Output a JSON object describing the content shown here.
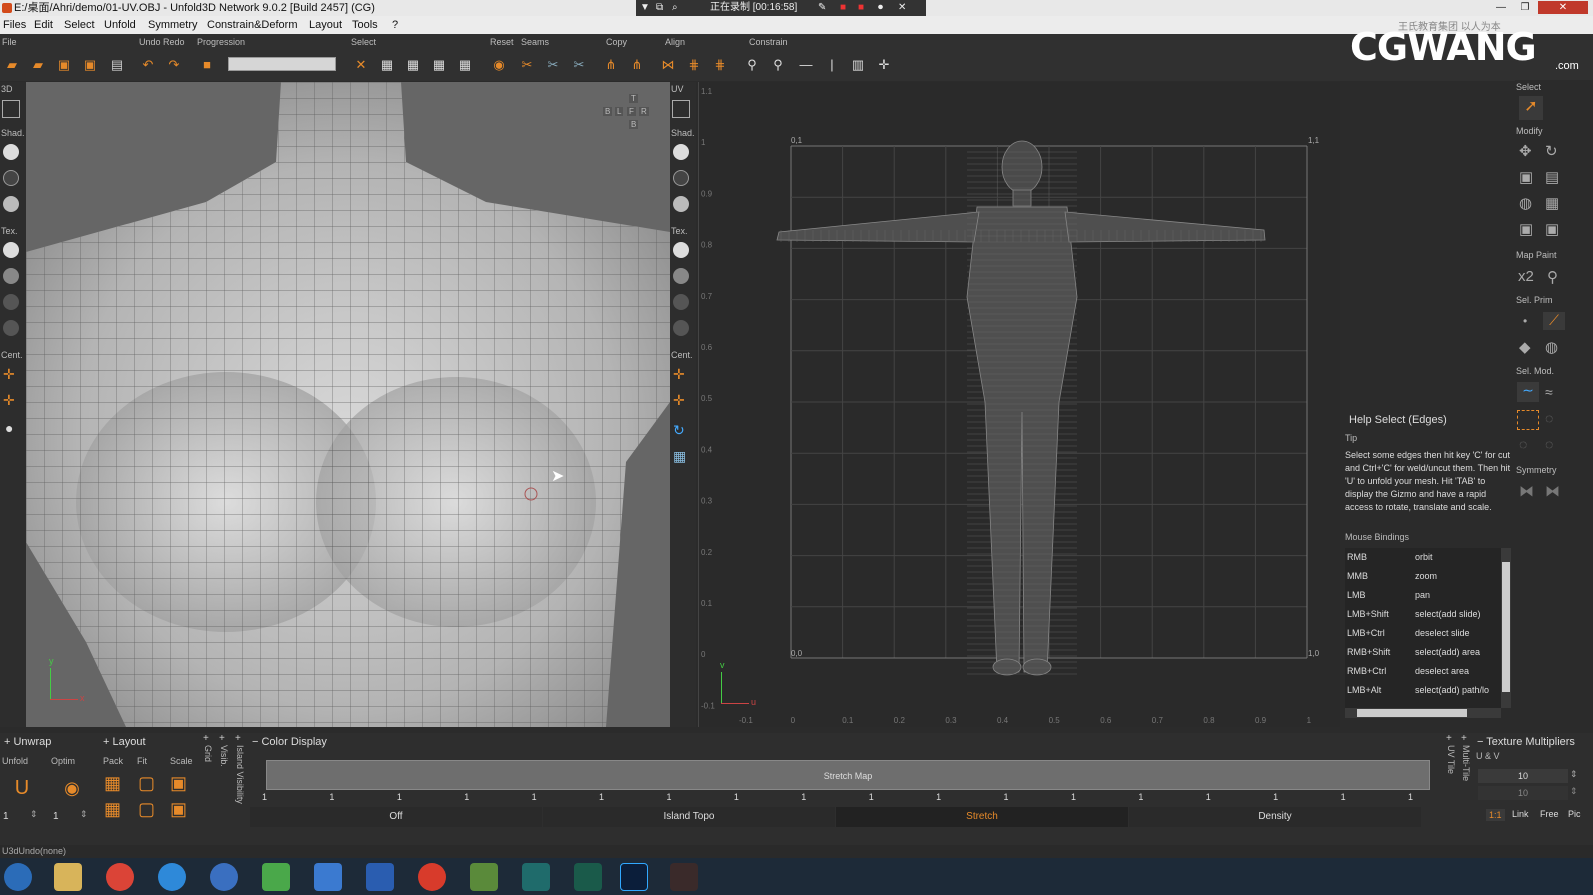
{
  "window": {
    "title": "E:/桌面/Ahri/demo/01-UV.OBJ - Unfold3D Network 9.0.2 [Build 2457] (CG)",
    "recording": "正在录制 [00:16:58]"
  },
  "menu": [
    "Files",
    "Edit",
    "Select",
    "Unfold",
    "Symmetry",
    "Constrain&Deform",
    "Layout",
    "Tools",
    "?"
  ],
  "toolbar": {
    "groups": [
      "File",
      "Undo Redo",
      "Progression",
      "Select",
      "Reset",
      "Seams",
      "Copy",
      "Align",
      "Constrain"
    ]
  },
  "logo": {
    "text": "CGWANG",
    "sub": ".com",
    "watermark": "王氏教育集团 以人为本"
  },
  "left_panel": {
    "header": "3D",
    "labels": [
      "Shad.",
      "Tex.",
      "Cent."
    ]
  },
  "uv_panel": {
    "header": "UV",
    "labels": [
      "Shad.",
      "Tex.",
      "Cent."
    ]
  },
  "viewcube": [
    "T",
    "B",
    "L",
    "F",
    "R",
    "B"
  ],
  "uv_view": {
    "corner_tl": "0,1",
    "corner_tr": "1,1",
    "corner_bl": "0,0",
    "corner_br": "1,0",
    "yticks": [
      "1.1",
      "1",
      "0.9",
      "0.8",
      "0.7",
      "0.6",
      "0.5",
      "0.4",
      "0.3",
      "0.2",
      "0.1",
      "0",
      "-0.1"
    ],
    "xticks": [
      "-0.1",
      "0",
      "0.1",
      "0.2",
      "0.3",
      "0.4",
      "0.5",
      "0.6",
      "0.7",
      "0.8",
      "0.9",
      "1"
    ],
    "axes": {
      "v": "v",
      "u": "u"
    }
  },
  "axes3d": {
    "y": "y",
    "x": "x"
  },
  "right_panel": {
    "labels": [
      "Select",
      "Modify",
      "Map Paint",
      "Sel. Prim",
      "Sel. Mod.",
      "Symmetry"
    ],
    "x2": "x2"
  },
  "help": {
    "title": "Help Select (Edges)",
    "tip_label": "Tip",
    "tip": "Select some edges then hit key 'C' for cut and Ctrl+'C' for weld/uncut them. Then hit 'U' to unfold your mesh. Hit 'TAB' to display the Gizmo and have a rapid access to rotate, translate and scale.",
    "bindings_label": "Mouse Bindings",
    "bindings": [
      [
        "RMB",
        "orbit"
      ],
      [
        "MMB",
        "zoom"
      ],
      [
        "LMB",
        "pan"
      ],
      [
        "LMB+Shift",
        "select(add slide)"
      ],
      [
        "LMB+Ctrl",
        "deselect slide"
      ],
      [
        "RMB+Shift",
        "select(add) area"
      ],
      [
        "RMB+Ctrl",
        "deselect area"
      ],
      [
        "LMB+Alt",
        "select(add) path/lo"
      ]
    ]
  },
  "bottom": {
    "unwrap": "Unwrap",
    "unfold": "Unfold",
    "optim": "Optim",
    "layout": "Layout",
    "pack": "Pack",
    "fit": "Fit",
    "scale": "Scale",
    "grid": "Grid",
    "visib": "Visib.",
    "island_visibility": "Island Visibility",
    "color_display": "Color Display",
    "stretch_map": "Stretch Map",
    "stretch_ticks": [
      "1",
      "1",
      "1",
      "1",
      "1",
      "1",
      "1",
      "1",
      "1",
      "1",
      "1",
      "1",
      "1",
      "1",
      "1",
      "1",
      "1",
      "1"
    ],
    "modes": [
      "Off",
      "Island Topo",
      "Stretch",
      "Density"
    ],
    "active_mode": "Stretch",
    "uv_tile": "UV Tile",
    "multi_tile": "Multi-Tile",
    "texture_multipliers": "Texture Multipliers",
    "u_v": "U & V",
    "mult1": "10",
    "mult2": "10",
    "link_buttons": [
      "1:1",
      "Link",
      "Free",
      "Pic"
    ],
    "unfold_val": "1",
    "optim_val": "1"
  },
  "status": "U3dUndo(none)"
}
